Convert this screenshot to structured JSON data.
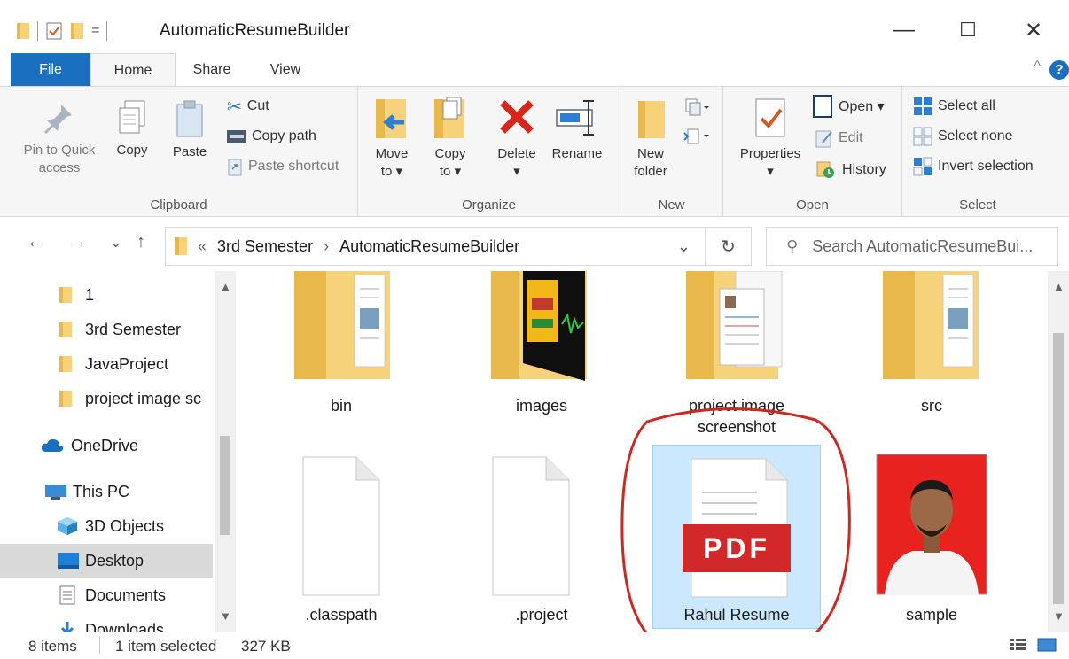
{
  "window": {
    "title": "AutomaticResumeBuilder",
    "minimize": "—",
    "maximize": "☐",
    "close": "✕"
  },
  "qat": {
    "dropdown": "="
  },
  "ribbon_tabs": {
    "file": "File",
    "home": "Home",
    "share": "Share",
    "view": "View",
    "help": "?",
    "collapse": "^"
  },
  "clipboard": {
    "pin_line1": "Pin to Quick",
    "pin_line2": "access",
    "copy": "Copy",
    "paste": "Paste",
    "cut": "Cut",
    "copy_path": "Copy path",
    "paste_shortcut": "Paste shortcut",
    "label": "Clipboard"
  },
  "organize": {
    "move_to_1": "Move",
    "move_to_2": "to ▾",
    "copy_to_1": "Copy",
    "copy_to_2": "to ▾",
    "delete": "Delete",
    "delete_arrow": "▾",
    "rename": "Rename",
    "label": "Organize"
  },
  "new_group": {
    "new_folder_1": "New",
    "new_folder_2": "folder",
    "label": "New"
  },
  "open_group": {
    "properties": "Properties",
    "properties_arrow": "▾",
    "open": "Open ▾",
    "edit": "Edit",
    "history": "History",
    "label": "Open"
  },
  "select_group": {
    "select_all": "Select all",
    "select_none": "Select none",
    "invert": "Invert selection",
    "label": "Select"
  },
  "address": {
    "back": "←",
    "forward": "→",
    "recent": "⌄",
    "up": "↑",
    "overflow": "«",
    "crumb1": "3rd Semester",
    "sep": "›",
    "crumb2": "AutomaticResumeBuilder",
    "dropdown": "⌄",
    "refresh": "↻",
    "search_placeholder": "Search AutomaticResumeBui..."
  },
  "nav_pane": {
    "items": [
      {
        "label": "1"
      },
      {
        "label": "3rd Semester"
      },
      {
        "label": "JavaProject"
      },
      {
        "label": "project image sc"
      },
      {
        "label": "OneDrive"
      },
      {
        "label": "This PC"
      },
      {
        "label": "3D Objects"
      },
      {
        "label": "Desktop"
      },
      {
        "label": "Documents"
      },
      {
        "label": "Downloads"
      }
    ]
  },
  "files": {
    "bin": "bin",
    "images": "images",
    "project_image_1": "project image",
    "project_image_2": "screenshot",
    "src": "src",
    "classpath": ".classpath",
    "project": ".project",
    "resume": "Rahul Resume",
    "pdf_badge": "PDF",
    "sample": "sample"
  },
  "status": {
    "items": "8 items",
    "selected": "1 item selected",
    "size": "327 KB"
  },
  "colors": {
    "accent": "#1a6fc0",
    "folder": "#f6d27a",
    "folder_dark": "#e8b84a",
    "selection": "#cce8ff",
    "pdf_red": "#d3282a",
    "annotation": "#d0281e"
  }
}
